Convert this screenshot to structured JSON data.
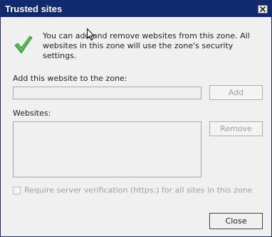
{
  "window": {
    "title": "Trusted sites"
  },
  "main": {
    "description": "You can add and remove websites from this zone. All websites in this zone will use the zone's security settings.",
    "add_label": "Add this website to the zone:",
    "add_input_value": "",
    "add_button": "Add",
    "websites_label": "Websites:",
    "websites": [],
    "remove_button": "Remove",
    "require_https_label": "Require server verification (https:) for all sites in this zone",
    "require_https_checked": false,
    "close_button": "Close"
  },
  "icons": {
    "status": "green-check-icon",
    "title_close": "close-icon"
  },
  "colors": {
    "titlebar": "#0f2a6e",
    "check_green": "#3fb53b",
    "disabled_text": "#a0a0a0"
  }
}
